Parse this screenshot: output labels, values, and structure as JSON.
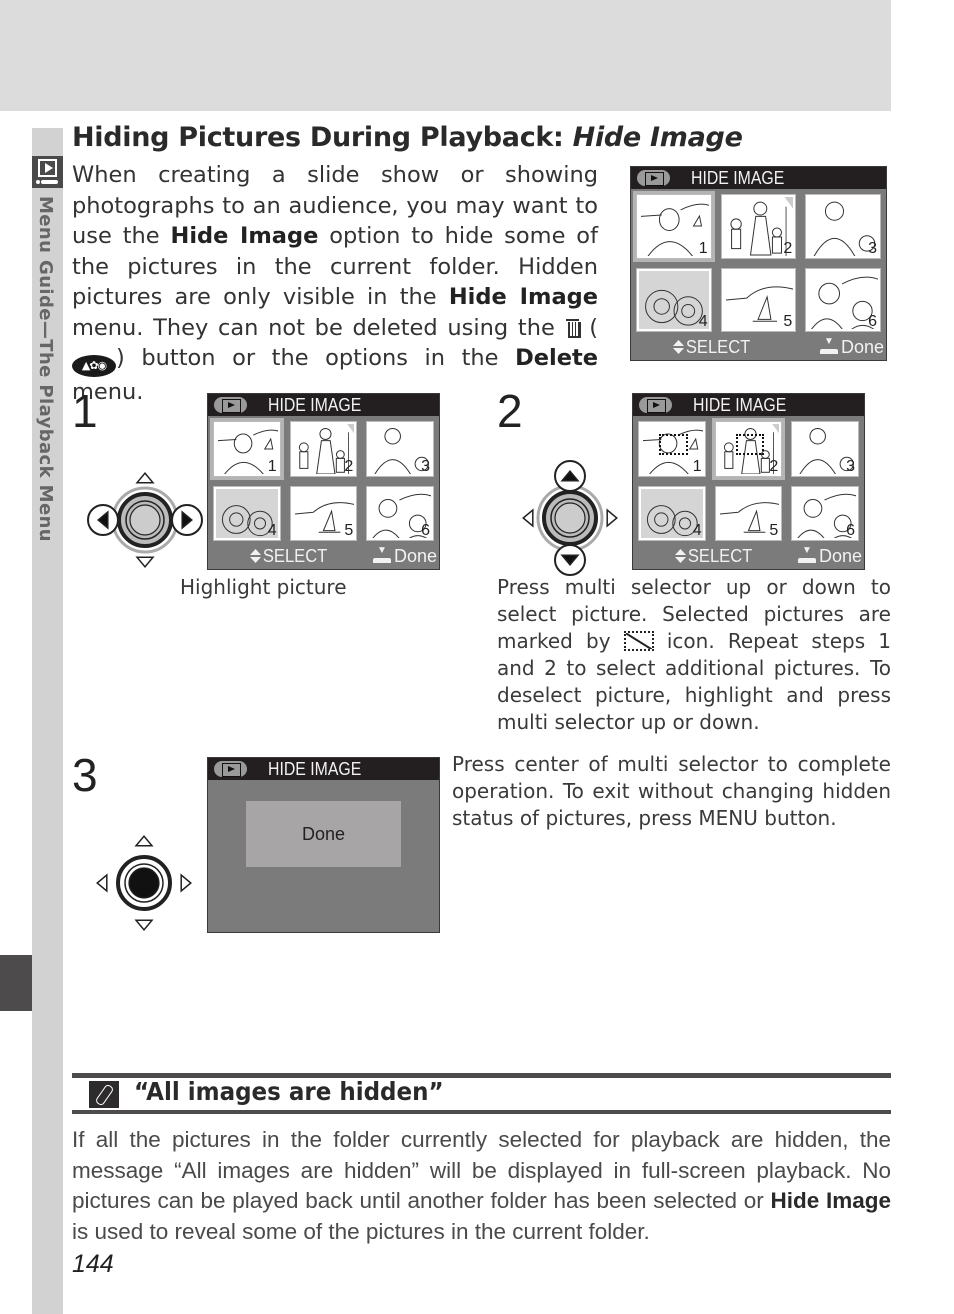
{
  "section_label": "Menu Guide—The Playback Menu",
  "title": {
    "prefix": "Hiding Pictures During Playback: ",
    "italic": "Hide Image"
  },
  "intro": {
    "t1": "When creating a slide show or showing photographs to an audience, you may want to use the ",
    "b1": "Hide Image",
    "t2": " option to hide some of the pictures in the current folder.  Hidden pictures are only visible in the ",
    "b2": "Hide Image",
    "t3": " menu.  They can not be deleted using the ",
    "icon_delete": "trash-icon",
    "t4": " (",
    "t5": ") button or the options in the ",
    "b3": "Delete",
    "t6": " menu."
  },
  "lcd": {
    "title": "HIDE IMAGE",
    "select_label": "SELECT",
    "done_label": "Done",
    "thumbnail_numbers": [
      "1",
      "2",
      "3",
      "4",
      "5",
      "6"
    ],
    "done_message": "Done"
  },
  "steps": [
    {
      "number": "1",
      "caption": "Highlight picture",
      "highlighted_thumbnail": 1,
      "pad_pressed": "left-right"
    },
    {
      "number": "2",
      "text_before_icon": "Press multi selector up or down to select picture.  Selected pictures are marked by ",
      "text_after_icon": " icon.  Repeat steps 1 and 2 to select additional pictures.  To deselect picture, highlight and press multi selector up or down.",
      "highlighted_thumbnail": 2,
      "hidden_thumbnails": [
        1,
        2
      ],
      "pad_pressed": "up-down"
    },
    {
      "number": "3",
      "text": "Press center of multi selector to complete operation.  To exit without changing hidden status of pictures, press MENU button.",
      "pad_pressed": "center"
    }
  ],
  "note": {
    "icon": "paperclip-note-icon",
    "title": "“All images are hidden”",
    "t1": "If all the pictures in the folder currently selected for playback are hidden, the message “All images are hidden” will be displayed in full-screen playback. No pictures can be played back until another folder has been selected or ",
    "b1": "Hide Image",
    "t2": " is used to reveal some of the pictures in the current folder."
  },
  "page_number": "144"
}
